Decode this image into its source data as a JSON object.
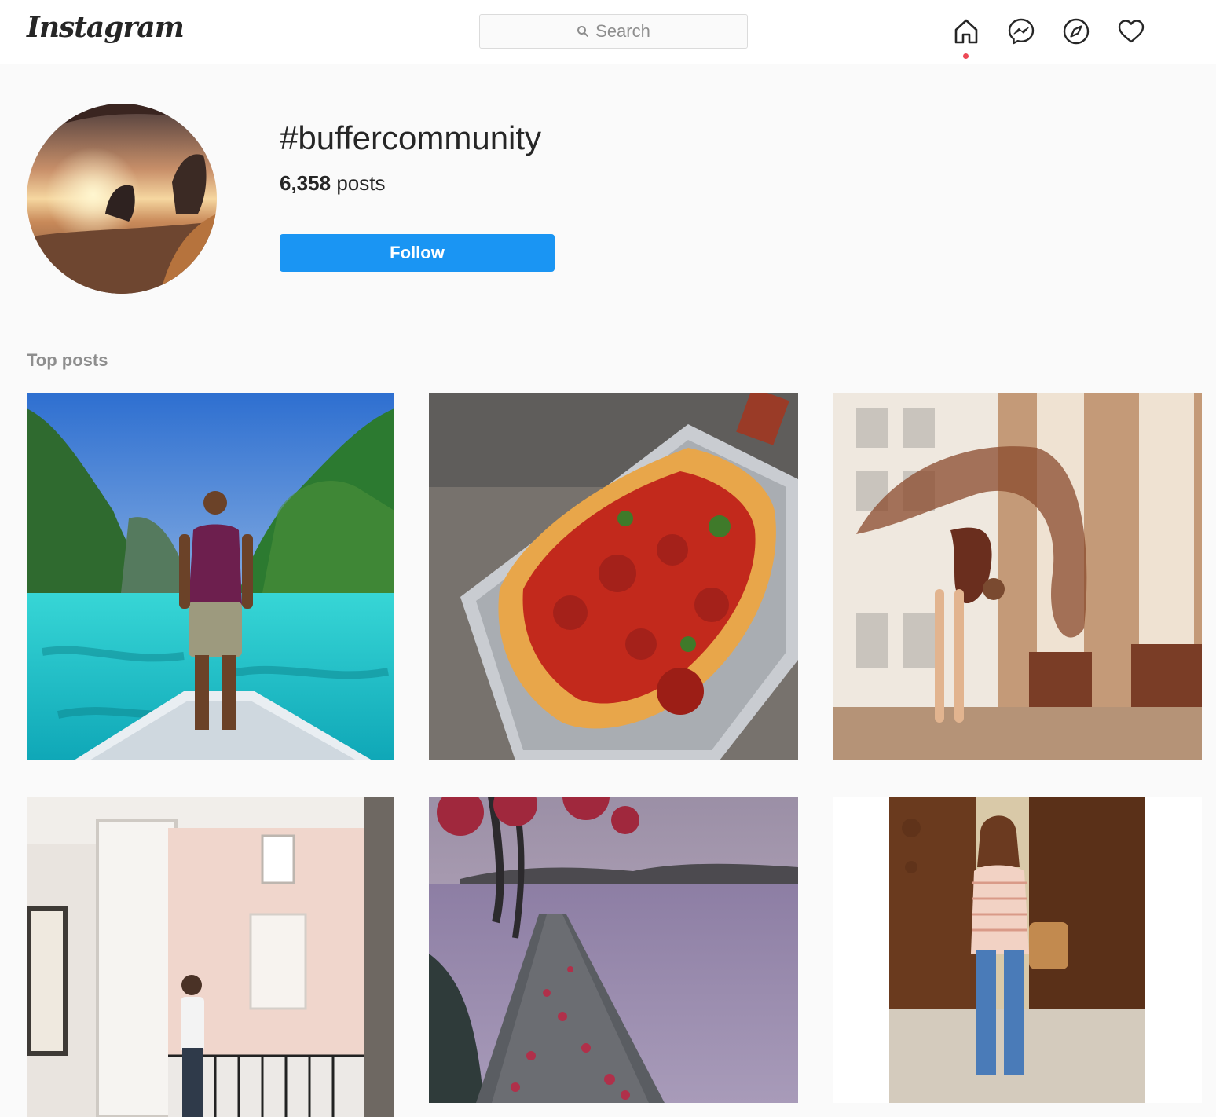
{
  "app": {
    "name": "Instagram"
  },
  "header": {
    "logo_text": "Instagram",
    "search": {
      "placeholder": "Search"
    },
    "nav": [
      {
        "name": "home",
        "icon": "home-icon",
        "active": true
      },
      {
        "name": "messenger",
        "icon": "messenger-icon"
      },
      {
        "name": "explore",
        "icon": "compass-icon"
      },
      {
        "name": "activity",
        "icon": "heart-icon"
      }
    ],
    "notification_dot_color": "#ed4956"
  },
  "hashtag": {
    "title": "#buffercommunity",
    "post_count": "6,358",
    "post_count_suffix": "posts",
    "follow_label": "Follow",
    "follow_color": "#1a95f3"
  },
  "section": {
    "label": "Top posts"
  },
  "posts": [
    {
      "subject": "man on boat bow in turquoise lagoon between green cliffs"
    },
    {
      "subject": "Detroit-style pepperoni pizza on a wire rack"
    },
    {
      "subject": "dancer in brown leotard arching back with flowing scarf"
    },
    {
      "subject": "woman standing by tall open window in a pink courtyard"
    },
    {
      "subject": "wooden dock with red leaves on a misty lake"
    },
    {
      "subject": "woman in striped top with tan bag before wooden doors"
    }
  ]
}
